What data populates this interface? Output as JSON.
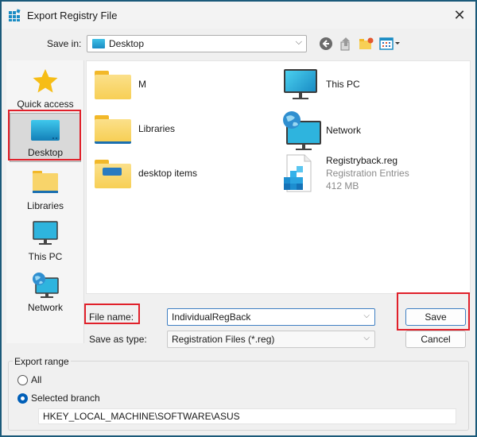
{
  "window": {
    "title": "Export Registry File",
    "close_icon": "close-icon"
  },
  "toolbar": {
    "save_in_label": "Save in:",
    "save_in_value": "Desktop",
    "buttons": [
      "back-icon",
      "up-folder-icon",
      "new-folder-icon",
      "view-menu-icon"
    ]
  },
  "places": [
    {
      "label": "Quick access",
      "icon": "star-icon",
      "selected": false
    },
    {
      "label": "Desktop",
      "icon": "desktop-icon",
      "selected": true
    },
    {
      "label": "Libraries",
      "icon": "libraries-icon",
      "selected": false
    },
    {
      "label": "This PC",
      "icon": "this-pc-icon",
      "selected": false
    },
    {
      "label": "Network",
      "icon": "network-icon",
      "selected": false
    }
  ],
  "files": [
    {
      "name": "M",
      "icon": "folder-icon"
    },
    {
      "name": "Libraries",
      "icon": "libraries-folder-icon"
    },
    {
      "name": "desktop items",
      "icon": "folder-icon"
    },
    {
      "name": "This PC",
      "icon": "this-pc-icon"
    },
    {
      "name": "Network",
      "icon": "network-icon"
    },
    {
      "name": "Registryback.reg",
      "type": "Registration Entries",
      "size": "412 MB",
      "icon": "reg-file-icon"
    }
  ],
  "form": {
    "file_name_label": "File name:",
    "file_name_value": "IndividualRegBack",
    "save_type_label": "Save as type:",
    "save_type_value": "Registration Files (*.reg)",
    "save_button": "Save",
    "cancel_button": "Cancel"
  },
  "export_range": {
    "title": "Export range",
    "options": [
      {
        "label": "All",
        "checked": false
      },
      {
        "label": "Selected branch",
        "checked": true
      }
    ],
    "branch_value": "HKEY_LOCAL_MACHINE\\SOFTWARE\\ASUS"
  }
}
